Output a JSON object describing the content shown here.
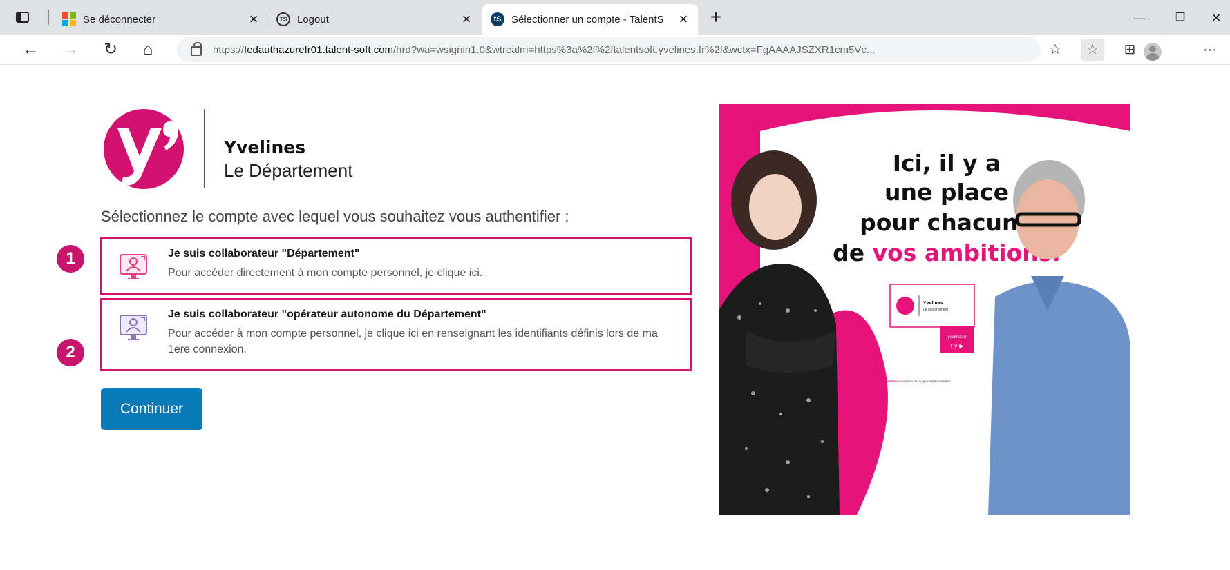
{
  "browser": {
    "tabs": [
      {
        "label": "Se déconnecter",
        "favicon": "microsoft-logo-icon"
      },
      {
        "label": "Logout",
        "favicon": "ts-logo-icon"
      },
      {
        "label": "Sélectionner un compte - TalentS",
        "favicon": "talentsoft-logo-icon"
      }
    ],
    "tab_close_glyph": "×",
    "new_tab_glyph": "+",
    "url": {
      "scheme": "https://",
      "host": "fedauthazurefr01.talent-soft.com",
      "path": "/hrd?wa=wsignin1.0&wtrealm=https%3a%2f%2ftalentsoft.yvelines.fr%2f&wctx=FgAAAAJSZXR1cm5Vc..."
    },
    "window_buttons": {
      "minimize": "—",
      "restore": "❐",
      "close": "✕"
    },
    "nav": {
      "back": "←",
      "forward": "→",
      "reload": "↻",
      "home": "⌂"
    },
    "tools": {
      "favorites_add": "☆",
      "favorites": "☆",
      "collections": "⊞",
      "more": "···"
    }
  },
  "page": {
    "brand": {
      "title": "Yvelines",
      "subtitle": "Le Département"
    },
    "instruction": "Sélectionnez le compte avec lequel vous souhaitez vous authentifier :",
    "options": [
      {
        "badge": "1",
        "title": "Je suis collaborateur \"Département\"",
        "description": "Pour accéder directement à mon compte personnel, je clique ici.",
        "icon_color": "#e0418a"
      },
      {
        "badge": "2",
        "title": "Je suis collaborateur \"opérateur autonome du Département\"",
        "description": "Pour accéder à mon compte personnel, je clique ici en renseignant les identifiants définis lors de ma 1ere connexion.",
        "icon_color": "#8a74b8"
      }
    ],
    "continue_label": "Continuer",
    "promo": {
      "headline_lines": [
        "Ici, il y a",
        "une place",
        "pour chacune"
      ],
      "headline_last_prefix": "de ",
      "headline_last_highlight": "vos ambitions.",
      "mini_logo_title": "Yvelines",
      "mini_logo_subtitle": "Le Département",
      "website": "yvelines.fr",
      "tagline_highlight": "Votre ambition",
      "tagline_rest": " au service de ce qui compte vraiment."
    },
    "colors": {
      "brand_pink": "#d3116e",
      "button_blue": "#0a7ab6"
    }
  }
}
